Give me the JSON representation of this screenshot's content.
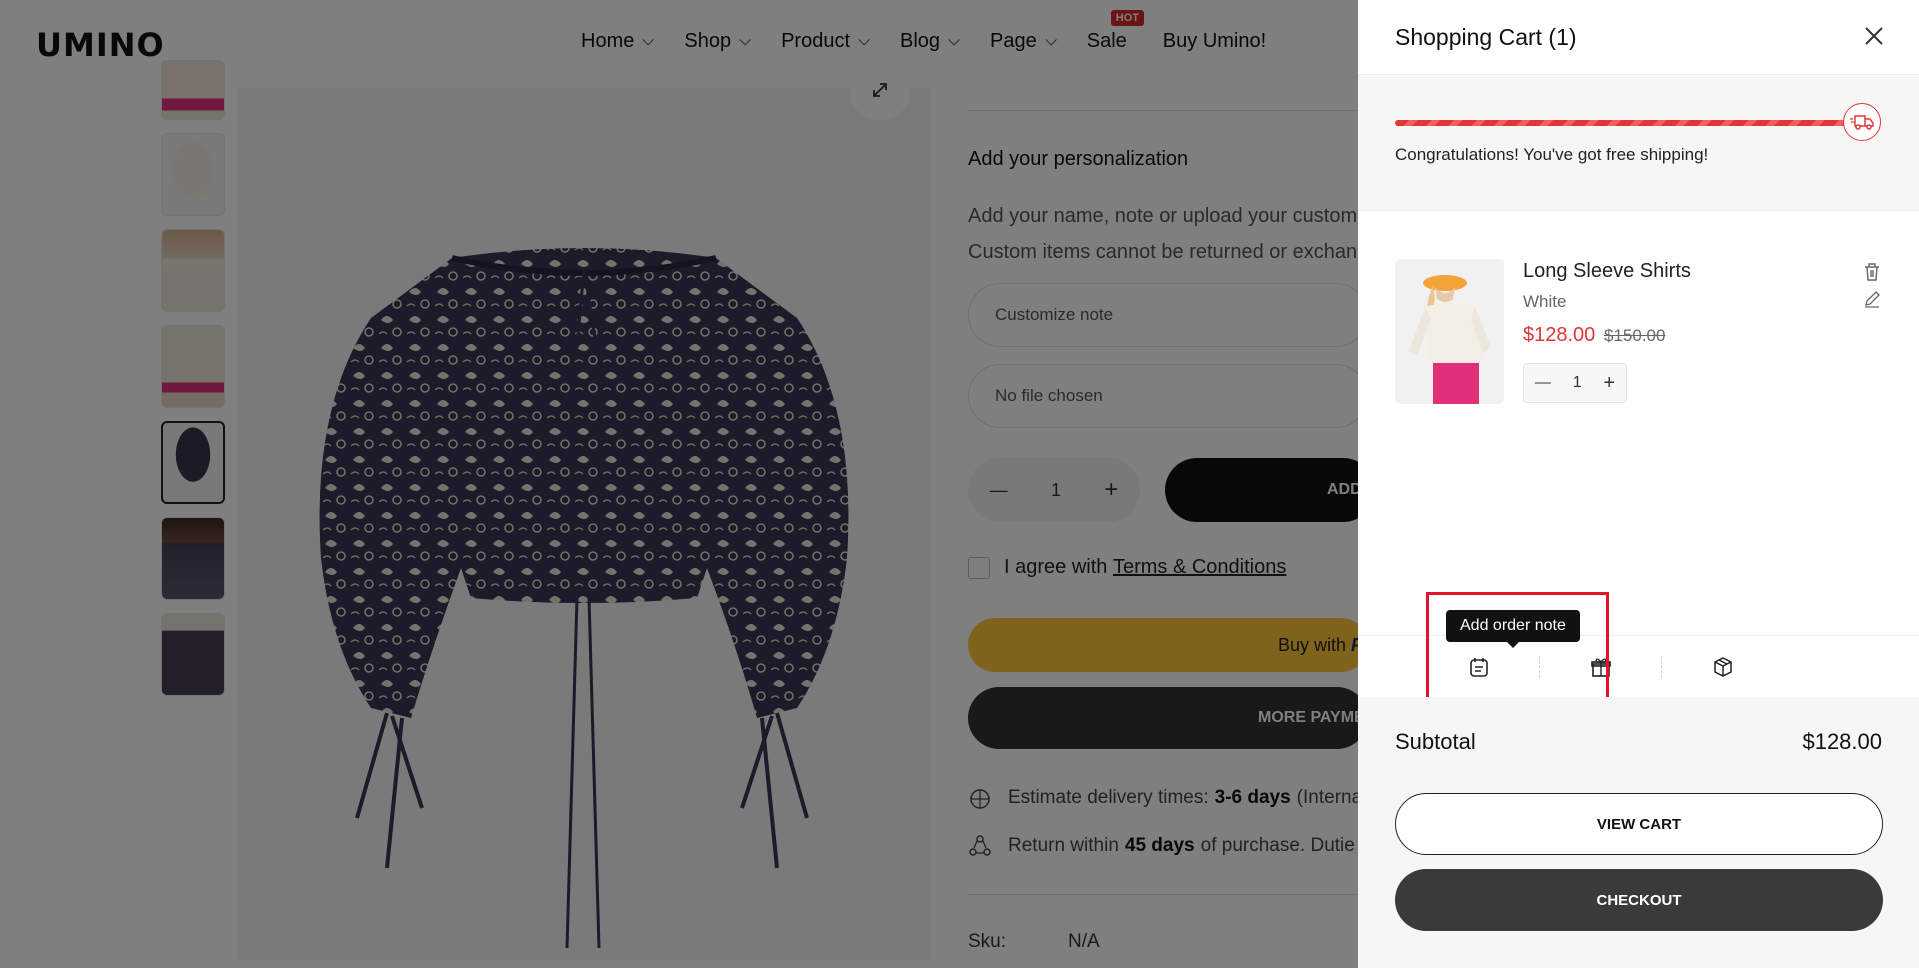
{
  "header": {
    "logo": "UMINO",
    "nav": [
      {
        "label": "Home",
        "has_dropdown": true
      },
      {
        "label": "Shop",
        "has_dropdown": true
      },
      {
        "label": "Product",
        "has_dropdown": true
      },
      {
        "label": "Blog",
        "has_dropdown": true
      },
      {
        "label": "Page",
        "has_dropdown": true
      },
      {
        "label": "Sale",
        "has_dropdown": false,
        "badge": "HOT"
      },
      {
        "label": "Buy Umino!",
        "has_dropdown": false
      }
    ]
  },
  "product_page": {
    "personalization_title": "Add your personalization",
    "personalization_desc_1": "Add your name, note or upload your customiz",
    "personalization_desc_2": "Custom items cannot be returned or exchange",
    "note_placeholder": "Customize note",
    "file_placeholder": "No file chosen",
    "quantity": "1",
    "add_button": "ADD",
    "agree_text": "I agree with",
    "terms_link": "Terms & Conditions",
    "buy_with": "Buy with",
    "buy_with_brand": "P",
    "more_payment": "MORE PAYME",
    "delivery_label": "Estimate delivery times:",
    "delivery_value": "3-6 days",
    "delivery_suffix": "(Interna",
    "return_label": "Return within",
    "return_value": "45 days",
    "return_suffix": "of purchase. Dutie",
    "sku_label": "Sku:",
    "sku_value": "N/A"
  },
  "cart": {
    "title": "Shopping Cart (1)",
    "shipping_message": "Congratulations! You've got free shipping!",
    "shipping_progress": 1.0,
    "items": [
      {
        "name": "Long Sleeve Shirts",
        "variant": "White",
        "price": "$128.00",
        "compare_price": "$150.00",
        "quantity": "1"
      }
    ],
    "tool_tooltip": "Add order note",
    "tools": [
      "note-icon",
      "gift-icon",
      "box-icon"
    ],
    "subtotal_label": "Subtotal",
    "subtotal_value": "$128.00",
    "view_cart": "VIEW CART",
    "checkout": "CHECKOUT"
  },
  "colors": {
    "accent_red": "#e23636",
    "highlight": "#e0152a",
    "paypal_yellow": "#ffc439",
    "overlay": "rgba(0,0,0,0.5)"
  }
}
